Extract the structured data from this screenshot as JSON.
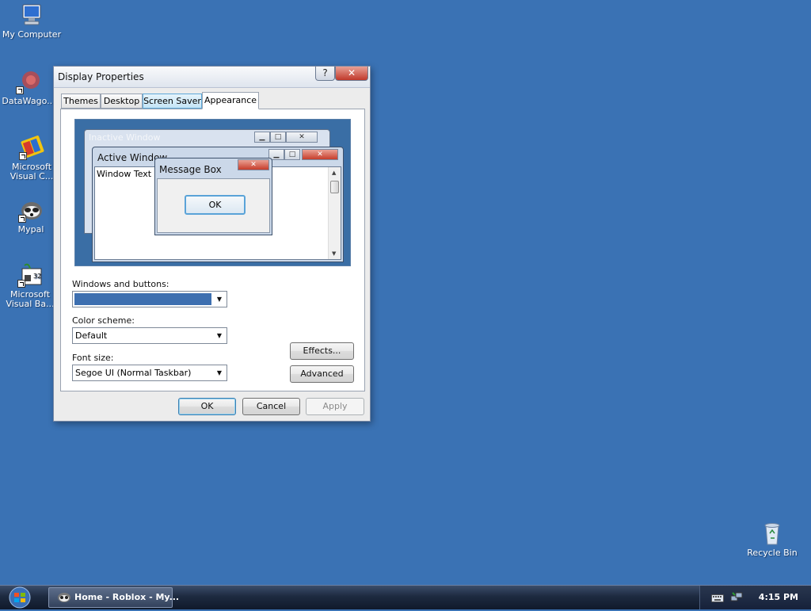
{
  "desktop": {
    "icons": [
      {
        "label": "My Computer",
        "icon": "computer-icon"
      },
      {
        "label": "DataWago...",
        "icon": "datawago-icon"
      },
      {
        "label": "Microsoft Visual C...",
        "icon": "visual-c-icon"
      },
      {
        "label": "Mypal",
        "icon": "mypal-icon"
      },
      {
        "label": "Microsoft Visual Ba...",
        "icon": "visual-basic-icon"
      },
      {
        "label": "Recycle Bin",
        "icon": "recycle-bin-icon"
      }
    ]
  },
  "dialog": {
    "title": "Display Properties",
    "help_glyph": "?",
    "close_glyph": "✕",
    "tabs": [
      "Themes",
      "Desktop",
      "Screen Saver",
      "Appearance"
    ],
    "active_tab": "Appearance",
    "preview": {
      "inactive_title": "Inactive Window",
      "active_title": "Active Window",
      "window_text": "Window Text",
      "message_box_title": "Message Box",
      "message_box_ok": "OK"
    },
    "windows_buttons": {
      "label": "Windows and buttons:",
      "value": ""
    },
    "color_scheme": {
      "label": "Color scheme:",
      "value": "Default"
    },
    "font_size": {
      "label": "Font size:",
      "value": "Segoe UI (Normal Taskbar)"
    },
    "effects_label": "Effects...",
    "advanced_label": "Advanced",
    "ok_label": "OK",
    "cancel_label": "Cancel",
    "apply_label": "Apply"
  },
  "taskbar": {
    "task_label": "Home - Roblox - My...",
    "clock": "4:15 PM",
    "tray_icons": [
      "keyboard-icon",
      "network-icon"
    ]
  },
  "colors": {
    "desktop": "#3a72b4",
    "preview_background": "#3a6ea5",
    "selected_scheme": "#3d6fb0",
    "close_button": "#c63d2b"
  }
}
